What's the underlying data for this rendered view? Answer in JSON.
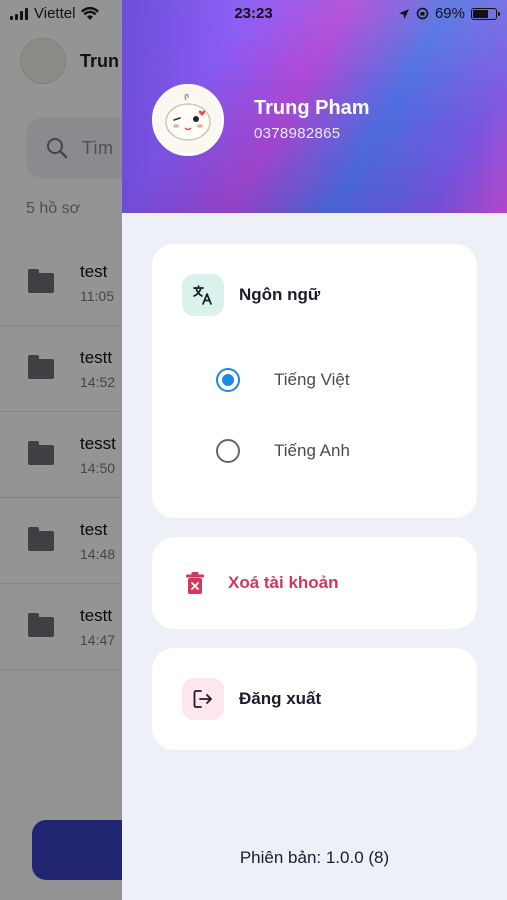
{
  "status_bar": {
    "carrier": "Viettel",
    "time": "23:23",
    "battery": "69%",
    "battery_level": 0.69
  },
  "background_screen": {
    "user_name": "Trun",
    "search_placeholder": "Tìm",
    "count": "5 hồ sơ",
    "items": [
      {
        "title": "test",
        "time": "11:05"
      },
      {
        "title": "testt",
        "time": "14:52"
      },
      {
        "title": "tesst",
        "time": "14:50"
      },
      {
        "title": "test",
        "time": "14:48"
      },
      {
        "title": "testt",
        "time": "14:47"
      }
    ]
  },
  "drawer": {
    "profile": {
      "name": "Trung Pham",
      "phone": "0378982865"
    },
    "language": {
      "title": "Ngôn ngữ",
      "options": [
        {
          "label": "Tiếng Việt",
          "selected": true
        },
        {
          "label": "Tiếng Anh",
          "selected": false
        }
      ]
    },
    "delete_account_label": "Xoá tài khoản",
    "logout_label": "Đăng xuất",
    "version": "Phiên bản: 1.0.0 (8)"
  },
  "colors": {
    "radio_selected": "#1e88e5",
    "delete_red": "#d0385e",
    "lang_tile": "#d9f3ec",
    "logout_tile": "#fde6ec"
  }
}
